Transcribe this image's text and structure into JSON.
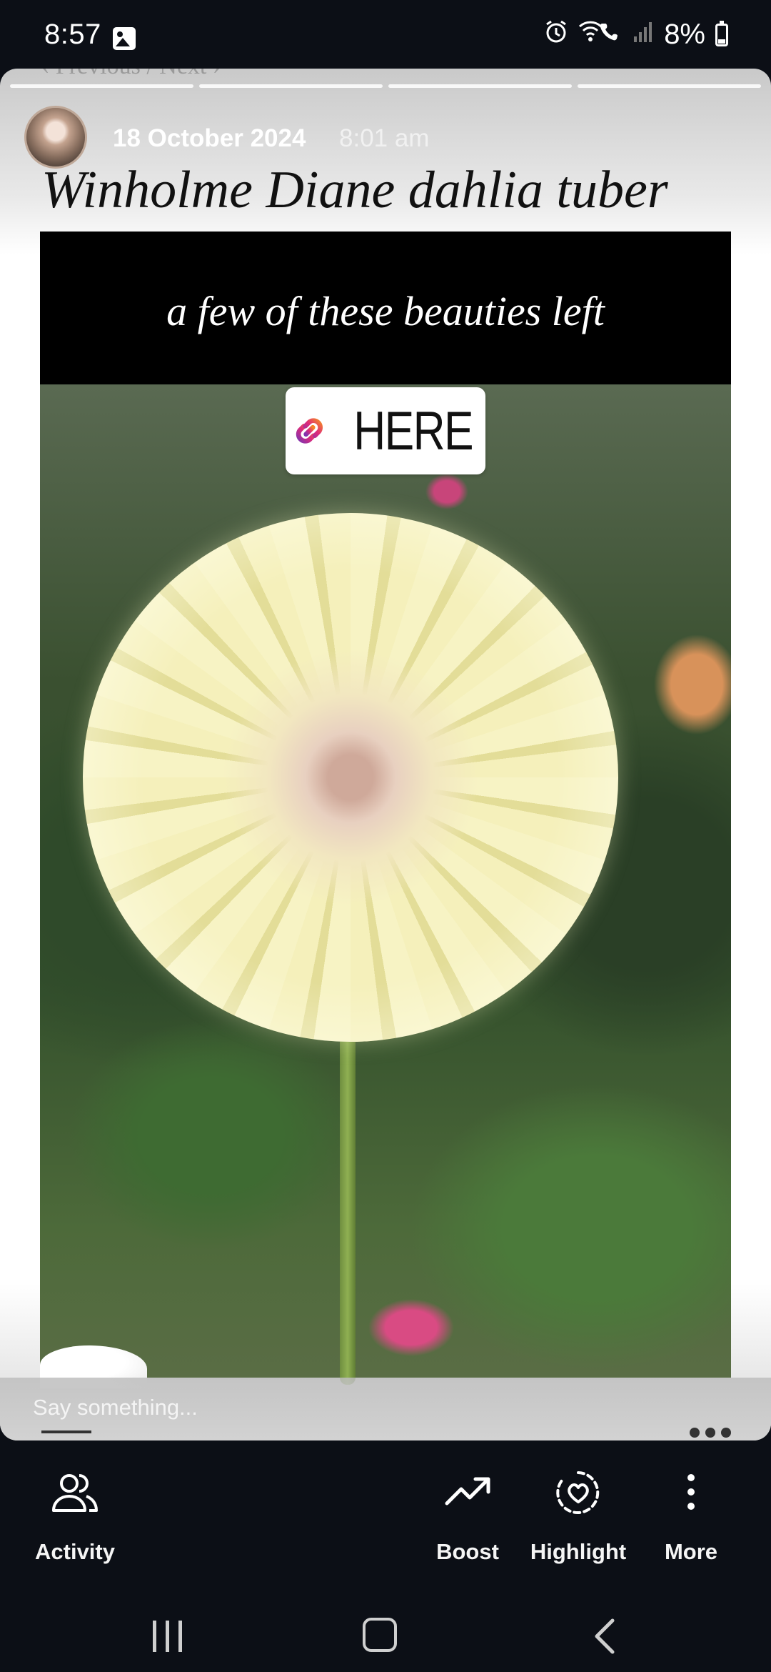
{
  "status_bar": {
    "time": "8:57",
    "battery": "8%",
    "icons": [
      "gallery-icon",
      "alarm-icon",
      "wifi-calling-icon",
      "signal-icon",
      "battery-charging-icon"
    ]
  },
  "story": {
    "nav_hint": "‹ Previous  /  Next ›",
    "date": "18 October 2024",
    "time": "8:01 am",
    "title": "Winholme Diane dahlia tuber",
    "caption": "a few of these beauties left",
    "link_sticker_label": "HERE",
    "comment_placeholder": "Say something..."
  },
  "actions": [
    {
      "label": "Activity",
      "icon": "people-icon"
    },
    {
      "label": "Boost",
      "icon": "trending-up-icon"
    },
    {
      "label": "Highlight",
      "icon": "highlight-heart-icon"
    },
    {
      "label": "More",
      "icon": "more-vertical-icon"
    }
  ],
  "colors": {
    "background": "#0c0f16",
    "sticker_gradient_start": "#f58529",
    "sticker_gradient_end": "#8134af"
  }
}
